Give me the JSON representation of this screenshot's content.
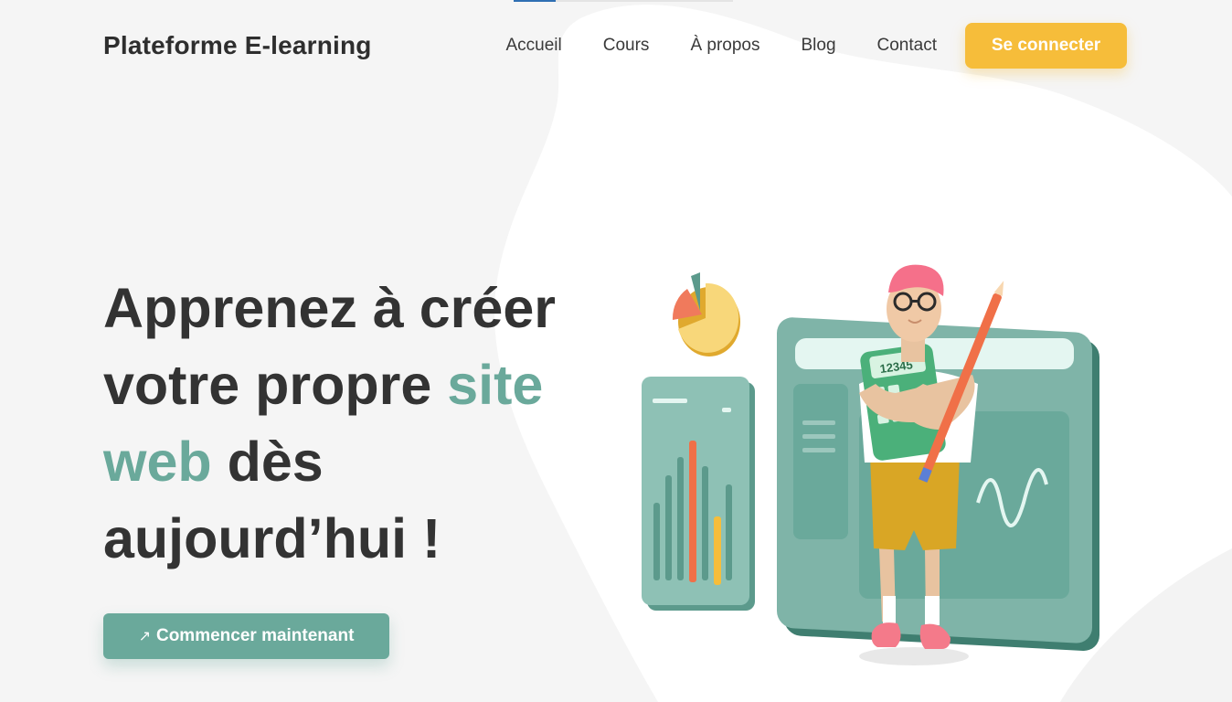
{
  "header": {
    "brand": "Plateforme E-learning",
    "nav": [
      {
        "label": "Accueil"
      },
      {
        "label": "Cours"
      },
      {
        "label": "À propos"
      },
      {
        "label": "Blog"
      },
      {
        "label": "Contact"
      }
    ],
    "login_label": "Se connecter"
  },
  "hero": {
    "title_part1": "Apprenez à créer votre propre ",
    "title_accent": "site web",
    "title_part2": " dès aujourd’hui !",
    "cta_label": "Commencer maintenant",
    "cta_icon": "arrow-up-right-icon"
  },
  "illustration": {
    "calculator_text": "12345",
    "icons": [
      "pie-chart-icon",
      "bar-chart-panel",
      "browser-window",
      "student-figure",
      "calculator-icon",
      "pencil-icon"
    ]
  },
  "colors": {
    "accent_green": "#6aa99b",
    "accent_yellow": "#f6bd3a",
    "text_dark": "#333333",
    "background": "#f5f5f5"
  }
}
